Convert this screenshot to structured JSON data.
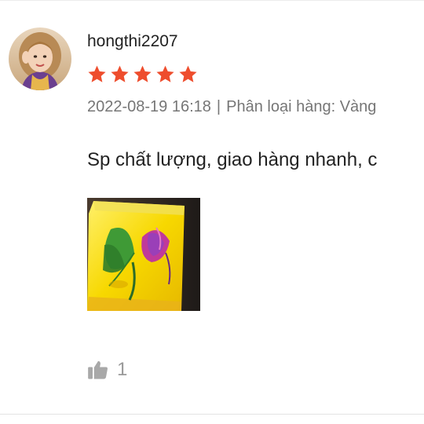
{
  "review": {
    "username": "hongthi2207",
    "rating": 5,
    "max_rating": 5,
    "date": "2022-08-19 16:18",
    "separator": "|",
    "variation_label": "Phân loại hàng:",
    "variation_value": "Vàng",
    "comment": "Sp chất lượng, giao hàng nhanh, c",
    "like_count": "1"
  },
  "icons": {
    "star": "star-icon",
    "like": "thumbs-up-icon"
  },
  "colors": {
    "star": "#ee4d2d",
    "meta_text": "#767676",
    "like": "#a8a8a8"
  }
}
